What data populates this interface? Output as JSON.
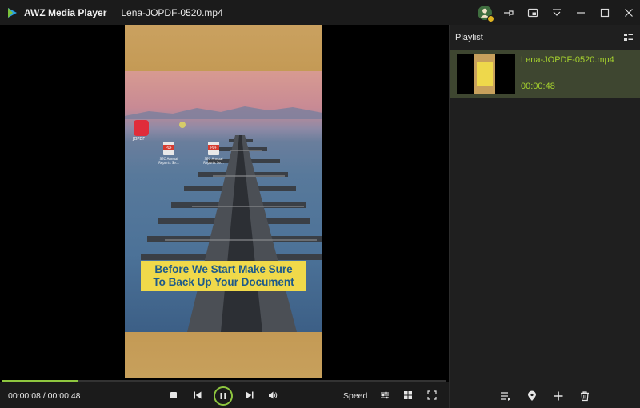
{
  "titlebar": {
    "app_name": "AWZ Media Player",
    "file_name": "Lena-JOPDF-0520.mp4",
    "buttons": [
      "account",
      "pin-to-top",
      "picture-in-picture",
      "menu",
      "minimize",
      "maximize",
      "close"
    ]
  },
  "video": {
    "caption_line1": "Before We Start Make Sure",
    "caption_line2": "To Back Up Your Document",
    "desktop_icons": [
      {
        "badge": "PDF",
        "caption": "JOPDF"
      },
      {
        "badge": "PDF",
        "caption": "SEC Annual Reports Se..."
      },
      {
        "badge": "PDF",
        "caption": "SEC Annual Reports Se..."
      }
    ]
  },
  "controls": {
    "time_current": "00:00:08",
    "time_separator": "/",
    "time_total": "00:00:48",
    "progress": 0.17,
    "speed_label": "Speed",
    "icons": [
      "stop-icon",
      "previous-icon",
      "pause-icon",
      "next-icon",
      "volume-icon",
      "equalizer-icon",
      "grid-icon",
      "fullscreen-icon"
    ]
  },
  "playlist": {
    "title": "Playlist",
    "items": [
      {
        "name": "Lena-JOPDF-0520.mp4",
        "duration": "00:00:48",
        "selected": true
      }
    ],
    "footer_icons": [
      "playlist-mode-icon",
      "location-icon",
      "add-icon",
      "delete-icon"
    ]
  },
  "colors": {
    "accent": "#8ec63f",
    "accent_text": "#a6d22e",
    "selected_row": "#3e4630",
    "titlebar_bg": "#1b1b1b",
    "panel_bg": "#1f1f1f",
    "caption_bg": "#f0d94a",
    "caption_text": "#1e5a8a"
  }
}
